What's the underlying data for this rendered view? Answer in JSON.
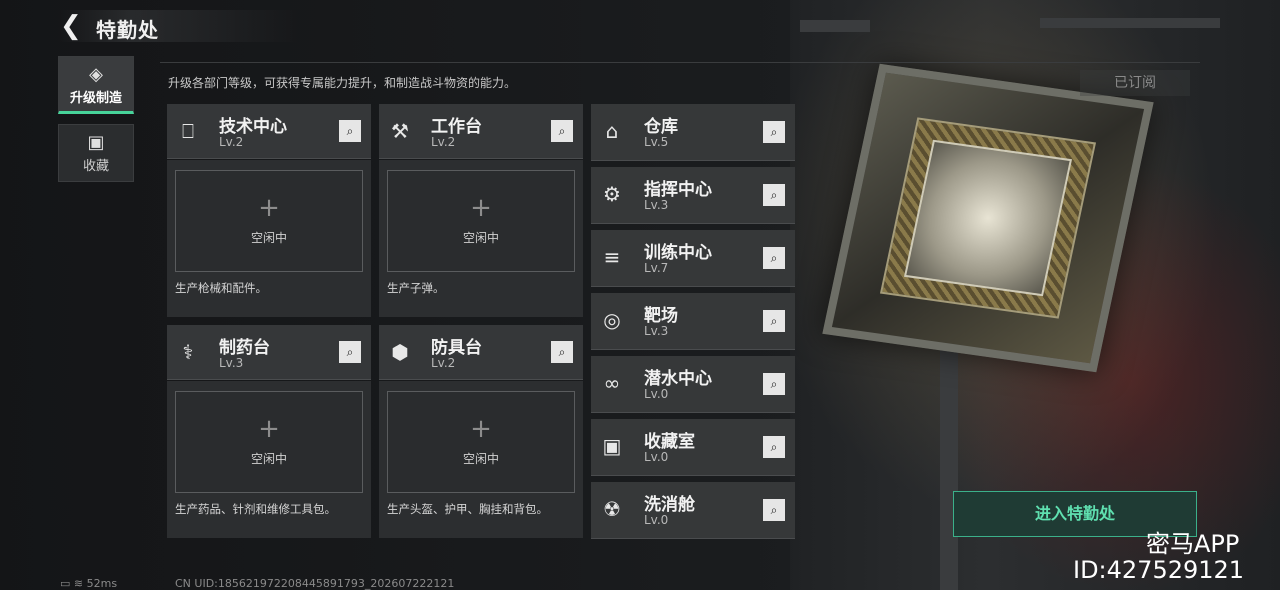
{
  "header": {
    "back_icon": "back-arrow-icon",
    "title": "特勤处"
  },
  "nav": [
    {
      "label": "升级制造",
      "icon": "upgrade-icon",
      "active": true
    },
    {
      "label": "收藏",
      "icon": "collection-icon",
      "active": false
    }
  ],
  "description": "升级各部门等级，可获得专属能力提升，和制造战斗物资的能力。",
  "subscribed_label": "已订阅",
  "workstations": [
    {
      "name": "技术中心",
      "level": "Lv.2",
      "icon": "tech-center-icon",
      "slot_state": "空闲中",
      "caption": "生产枪械和配件。"
    },
    {
      "name": "工作台",
      "level": "Lv.2",
      "icon": "workbench-icon",
      "slot_state": "空闲中",
      "caption": "生产子弹。"
    },
    {
      "name": "制药台",
      "level": "Lv.3",
      "icon": "pharmacy-icon",
      "slot_state": "空闲中",
      "caption": "生产药品、针剂和维修工具包。"
    },
    {
      "name": "防具台",
      "level": "Lv.2",
      "icon": "armor-bench-icon",
      "slot_state": "空闲中",
      "caption": "生产头盔、护甲、胸挂和背包。"
    }
  ],
  "slot_plus": "+",
  "facilities": [
    {
      "name": "仓库",
      "level": "Lv.5",
      "icon": "warehouse-icon"
    },
    {
      "name": "指挥中心",
      "level": "Lv.3",
      "icon": "command-center-icon"
    },
    {
      "name": "训练中心",
      "level": "Lv.7",
      "icon": "training-center-icon"
    },
    {
      "name": "靶场",
      "level": "Lv.3",
      "icon": "shooting-range-icon"
    },
    {
      "name": "潜水中心",
      "level": "Lv.0",
      "icon": "diving-center-icon"
    },
    {
      "name": "收藏室",
      "level": "Lv.0",
      "icon": "collection-room-icon"
    },
    {
      "name": "洗消舱",
      "level": "Lv.0",
      "icon": "decontamination-icon"
    }
  ],
  "enter_button": "进入特勤处",
  "watermark": {
    "line1": "密马APP",
    "line2": "ID:427529121"
  },
  "status": {
    "ping": "52ms",
    "uid": "CN UID:185621972208445891793_202607222121"
  },
  "colors": {
    "accent": "#47d39a",
    "panel": "#353739",
    "background": "#1b1d1f"
  }
}
